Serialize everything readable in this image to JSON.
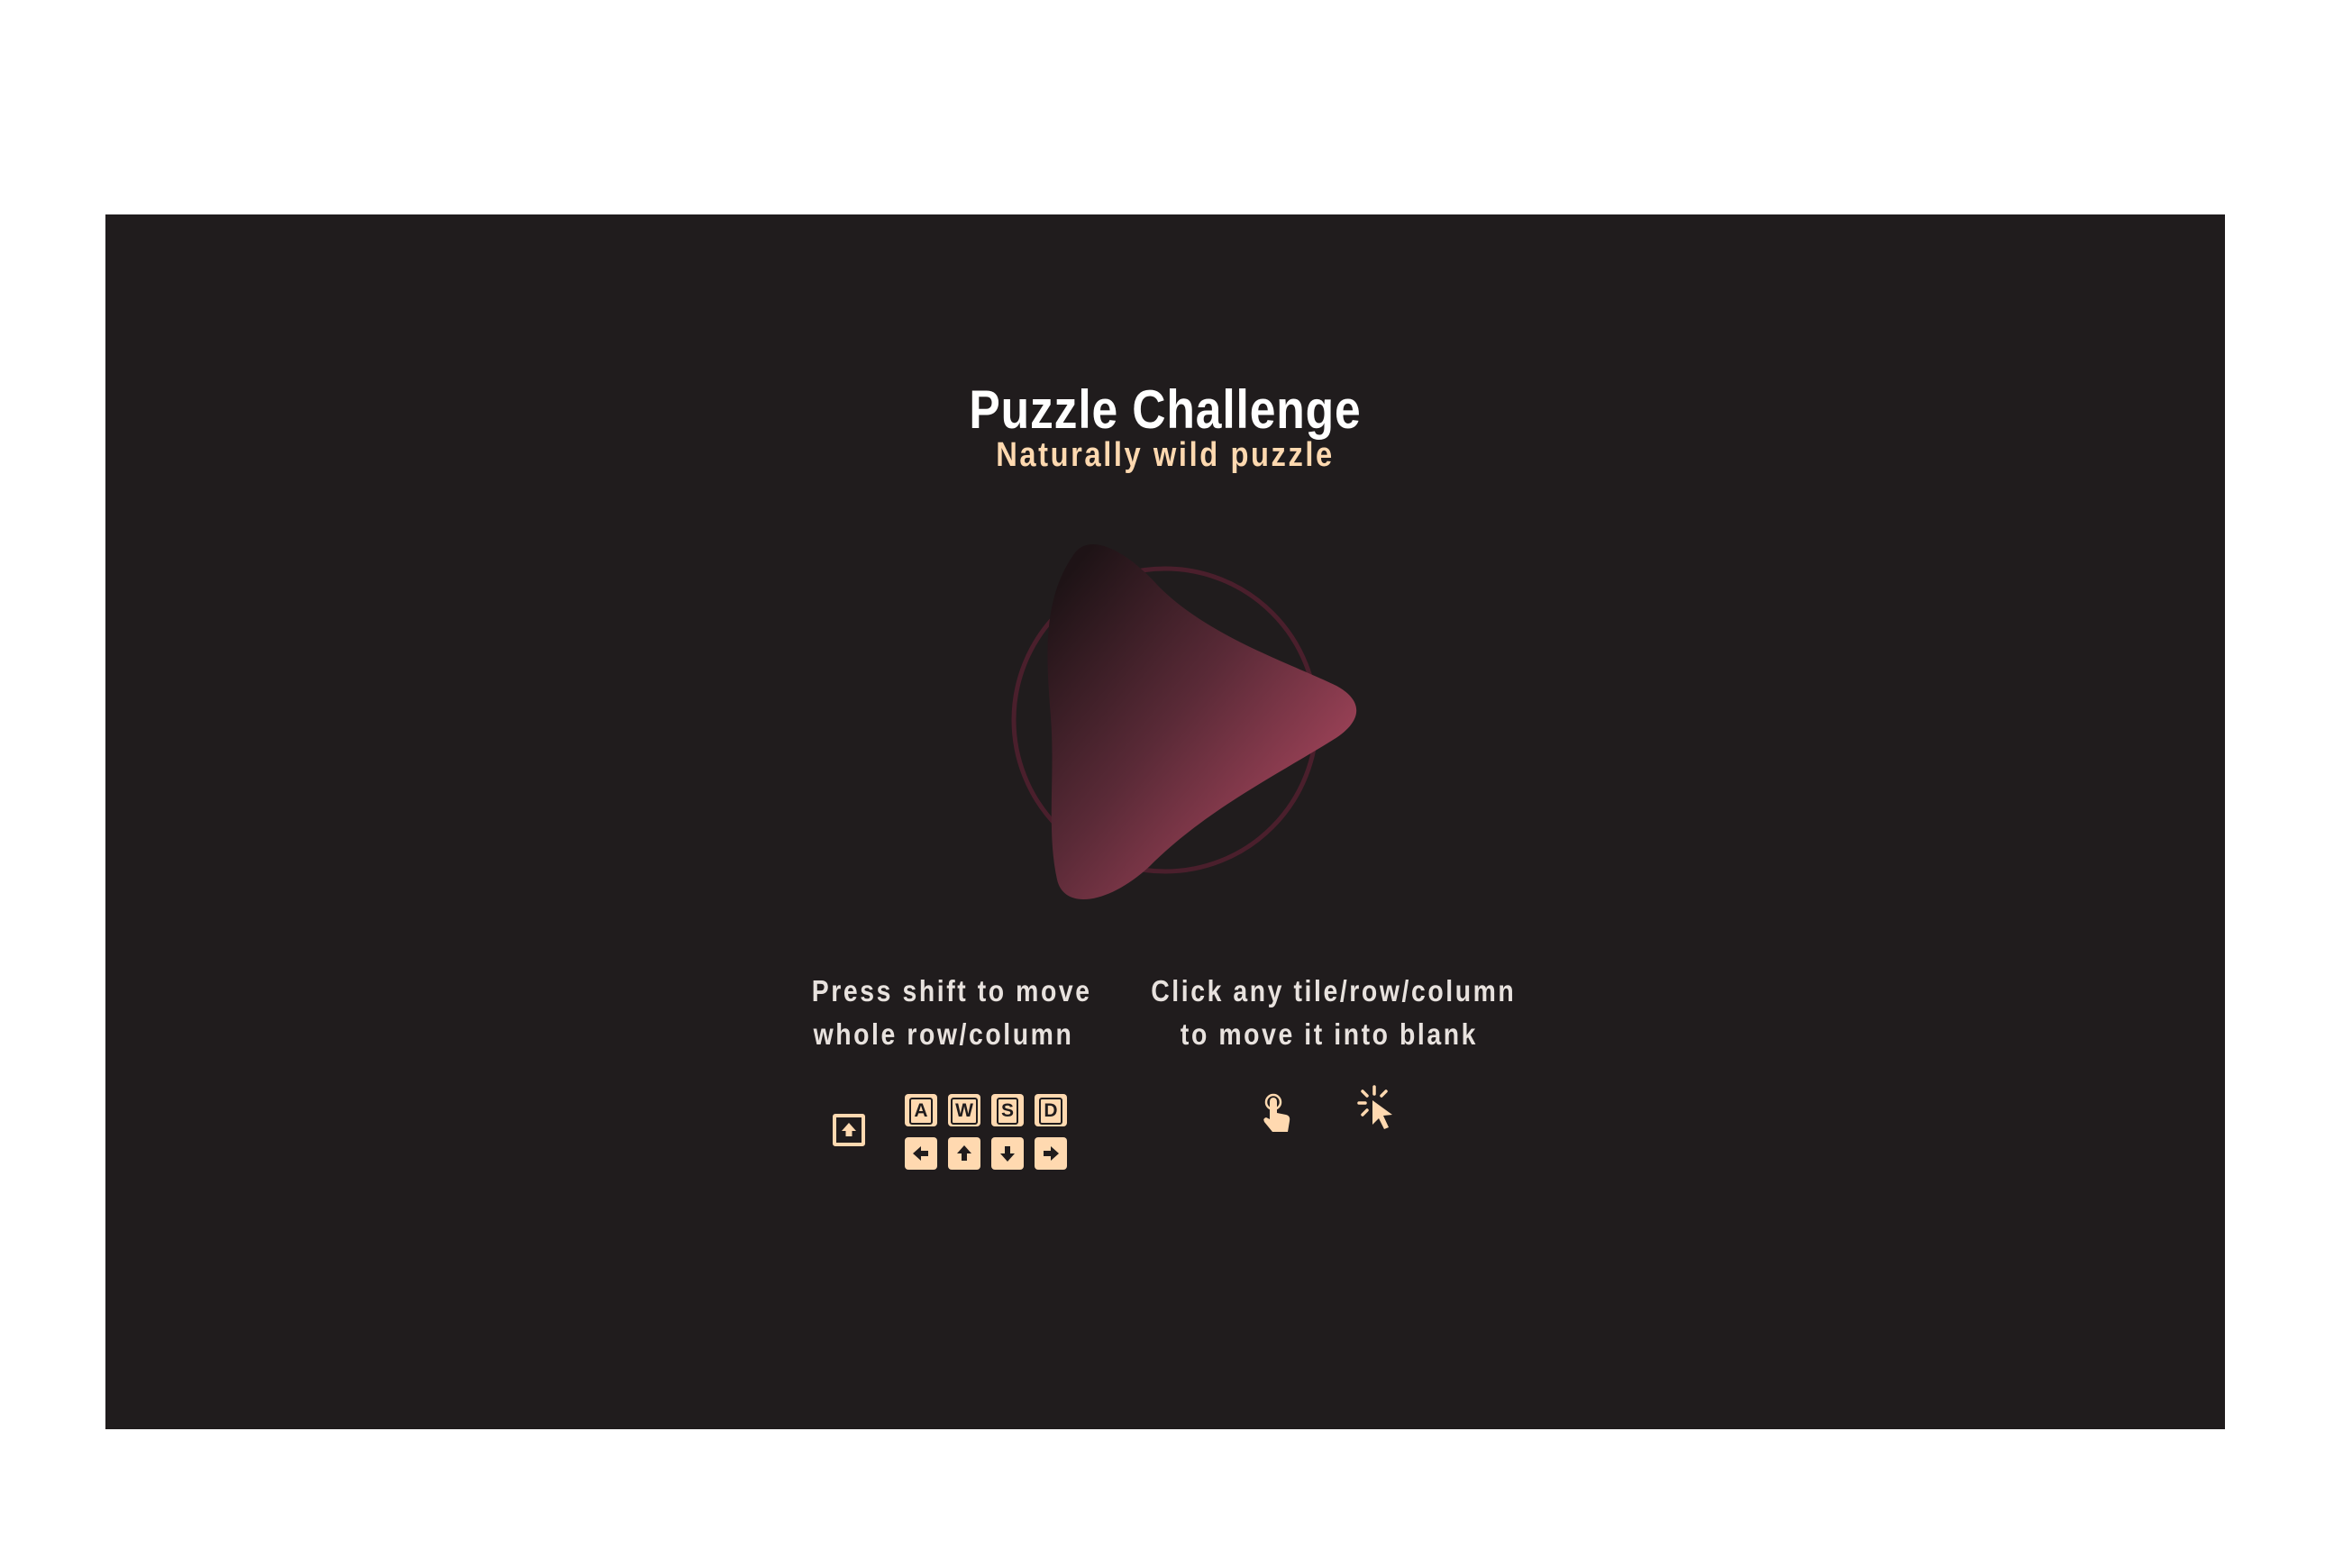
{
  "game": {
    "title": "Puzzle Challenge",
    "subtitle": "Naturally wild puzzle"
  },
  "play_button": {
    "icon": "play-icon",
    "gradient_start": "#1e1316",
    "gradient_end": "#b24a62",
    "ring_color": "#4a1f2c"
  },
  "instructions": {
    "keyboard": {
      "line1": "Press shift to move",
      "line2": "whole row/column",
      "modifier_icon": "shift-key-icon",
      "letter_keys": [
        "A",
        "W",
        "S",
        "D"
      ],
      "arrow_keys": [
        "left-arrow-key-icon",
        "up-arrow-key-icon",
        "down-arrow-key-icon",
        "right-arrow-key-icon"
      ]
    },
    "mouse": {
      "line1": "Click any tile/row/column",
      "line2": "to move it into blank",
      "icons": [
        "touch-icon",
        "mouse-click-icon"
      ]
    }
  },
  "colors": {
    "background": "#201c1d",
    "accent": "#ffd9b0",
    "title": "#ffffff"
  }
}
